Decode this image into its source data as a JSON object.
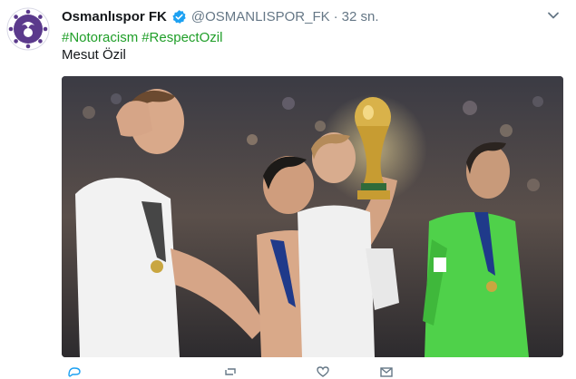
{
  "tweet": {
    "display_name": "Osmanlıspor FK",
    "handle": "@OSMANLISPOR_FK",
    "separator": "·",
    "time": "32 sn.",
    "hashtags": [
      "#Notoracism",
      "#RespectOzil"
    ],
    "text": "Mesut Özil"
  },
  "icons": {
    "avatar": "osmanlispor-club-logo",
    "verified": "verified-badge-icon",
    "caret": "chevron-down-icon",
    "actions": [
      "reply-icon",
      "retweet-icon",
      "like-icon",
      "message-icon"
    ]
  },
  "colors": {
    "hashtag": "#1f9e28",
    "verified": "#1da1f2",
    "club_purple": "#5b3a8c",
    "muted": "#657786"
  }
}
